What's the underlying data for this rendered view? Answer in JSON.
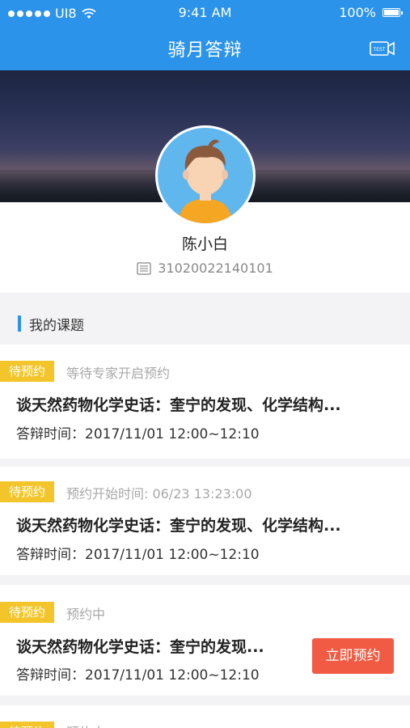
{
  "statusbar": {
    "carrier": "UI8",
    "time": "9:41 AM",
    "battery": "100%"
  },
  "navbar": {
    "title": "骑月答辩"
  },
  "profile": {
    "name": "陈小白",
    "id": "31020022140101"
  },
  "section": {
    "title": "我的课题"
  },
  "topics": [
    {
      "badge": "待预约",
      "status": "等待专家开启预约",
      "title": "谈天然药物化学史话：奎宁的发现、化学结构...",
      "time": "答辩时间：2017/11/01 12:00~12:10"
    },
    {
      "badge": "待预约",
      "status": "预约开始时间: 06/23   13:23:00",
      "title": "谈天然药物化学史话：奎宁的发现、化学结构...",
      "time": "答辩时间：2017/11/01 12:00~12:10"
    },
    {
      "badge": "待预约",
      "status": "预约中",
      "title": "谈天然药物化学史话：奎宁的发现...",
      "time": "答辩时间：2017/11/01 12:00~12:10",
      "action": "立即预约"
    },
    {
      "badge": "待预约",
      "status": "预约中"
    }
  ],
  "colors": {
    "primary": "#2b93ea",
    "badge": "#f4c52a",
    "action": "#f25b43"
  },
  "icons": {
    "camera": "test-camera-icon",
    "id": "id-card-icon",
    "wifi": "wifi-icon",
    "signal": "signal-dots-icon"
  }
}
